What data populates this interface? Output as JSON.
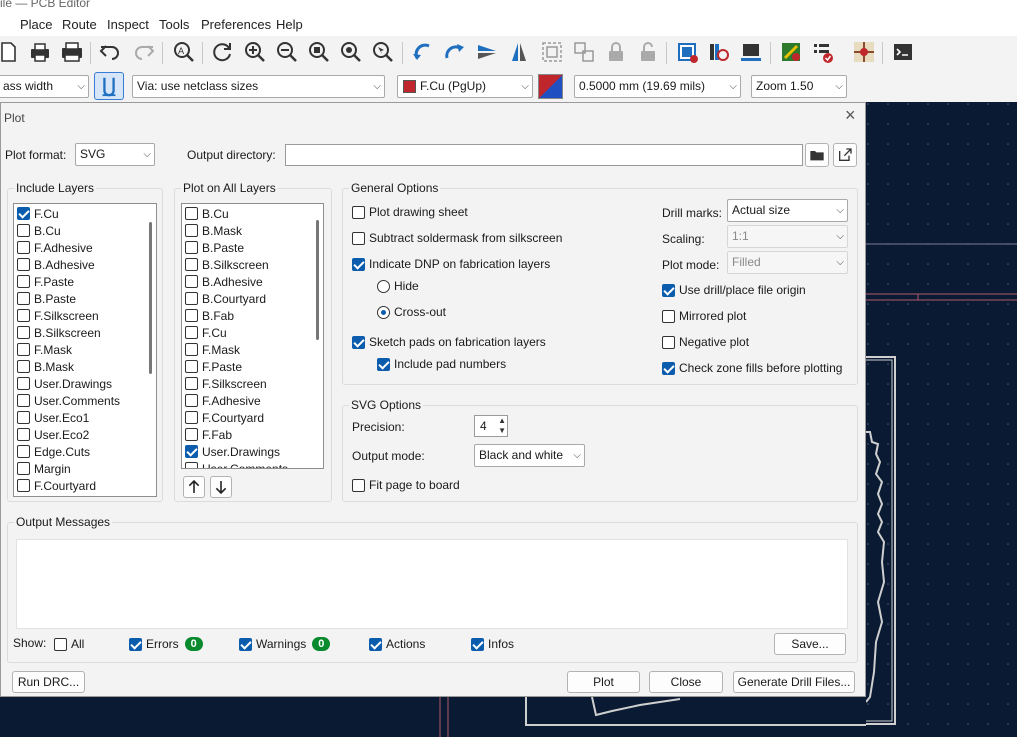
{
  "window": {
    "title": "ile — PCB Editor"
  },
  "menubar": {
    "items": [
      "Place",
      "Route",
      "Inspect",
      "Tools",
      "Preferences",
      "Help"
    ]
  },
  "toolbar2": {
    "track_width": "ass width",
    "via_size": "Via: use netclass sizes",
    "layer": "F.Cu (PgUp)",
    "layer_color": "#c0272d",
    "grid": "0.5000 mm (19.69 mils)",
    "zoom": "Zoom 1.50"
  },
  "dialog": {
    "title": "Plot",
    "plot_format_label": "Plot format:",
    "plot_format_value": "SVG",
    "output_dir_label": "Output directory:",
    "output_dir_value": "",
    "include_layers": {
      "title": "Include Layers",
      "items": [
        {
          "label": "F.Cu",
          "checked": true
        },
        {
          "label": "B.Cu",
          "checked": false
        },
        {
          "label": "F.Adhesive",
          "checked": false
        },
        {
          "label": "B.Adhesive",
          "checked": false
        },
        {
          "label": "F.Paste",
          "checked": false
        },
        {
          "label": "B.Paste",
          "checked": false
        },
        {
          "label": "F.Silkscreen",
          "checked": false
        },
        {
          "label": "B.Silkscreen",
          "checked": false
        },
        {
          "label": "F.Mask",
          "checked": false
        },
        {
          "label": "B.Mask",
          "checked": false
        },
        {
          "label": "User.Drawings",
          "checked": false
        },
        {
          "label": "User.Comments",
          "checked": false
        },
        {
          "label": "User.Eco1",
          "checked": false
        },
        {
          "label": "User.Eco2",
          "checked": false
        },
        {
          "label": "Edge.Cuts",
          "checked": false
        },
        {
          "label": "Margin",
          "checked": false
        },
        {
          "label": "F.Courtyard",
          "checked": false
        }
      ]
    },
    "plot_all_layers": {
      "title": "Plot on All Layers",
      "items": [
        {
          "label": "B.Cu",
          "checked": false
        },
        {
          "label": "B.Mask",
          "checked": false
        },
        {
          "label": "B.Paste",
          "checked": false
        },
        {
          "label": "B.Silkscreen",
          "checked": false
        },
        {
          "label": "B.Adhesive",
          "checked": false
        },
        {
          "label": "B.Courtyard",
          "checked": false
        },
        {
          "label": "B.Fab",
          "checked": false
        },
        {
          "label": "F.Cu",
          "checked": false
        },
        {
          "label": "F.Mask",
          "checked": false
        },
        {
          "label": "F.Paste",
          "checked": false
        },
        {
          "label": "F.Silkscreen",
          "checked": false
        },
        {
          "label": "F.Adhesive",
          "checked": false
        },
        {
          "label": "F.Courtyard",
          "checked": false
        },
        {
          "label": "F.Fab",
          "checked": false
        },
        {
          "label": "User.Drawings",
          "checked": true
        },
        {
          "label": "User.Comments",
          "checked": false
        }
      ]
    },
    "general": {
      "title": "General Options",
      "plot_drawing_sheet": "Plot drawing sheet",
      "subtract_soldermask": "Subtract soldermask from silkscreen",
      "indicate_dnp": "Indicate DNP on fabrication layers",
      "hide": "Hide",
      "cross_out": "Cross-out",
      "sketch_pads": "Sketch pads on fabrication layers",
      "include_pad_numbers": "Include pad numbers",
      "drill_marks_label": "Drill marks:",
      "drill_marks_value": "Actual size",
      "scaling_label": "Scaling:",
      "scaling_value": "1:1",
      "plot_mode_label": "Plot mode:",
      "plot_mode_value": "Filled",
      "use_drill_origin": "Use drill/place file origin",
      "mirrored_plot": "Mirrored plot",
      "negative_plot": "Negative plot",
      "check_zone_fills": "Check zone fills before plotting"
    },
    "svg": {
      "title": "SVG Options",
      "precision_label": "Precision:",
      "precision_value": "4",
      "output_mode_label": "Output mode:",
      "output_mode_value": "Black and white",
      "fit_page": "Fit page to board"
    },
    "messages": {
      "title": "Output Messages",
      "show_label": "Show:",
      "all": "All",
      "errors": "Errors",
      "errors_count": "0",
      "warnings": "Warnings",
      "warnings_count": "0",
      "actions": "Actions",
      "infos": "Infos",
      "save": "Save..."
    },
    "buttons": {
      "run_drc": "Run DRC...",
      "plot": "Plot",
      "close": "Close",
      "generate_drill": "Generate Drill Files..."
    }
  }
}
